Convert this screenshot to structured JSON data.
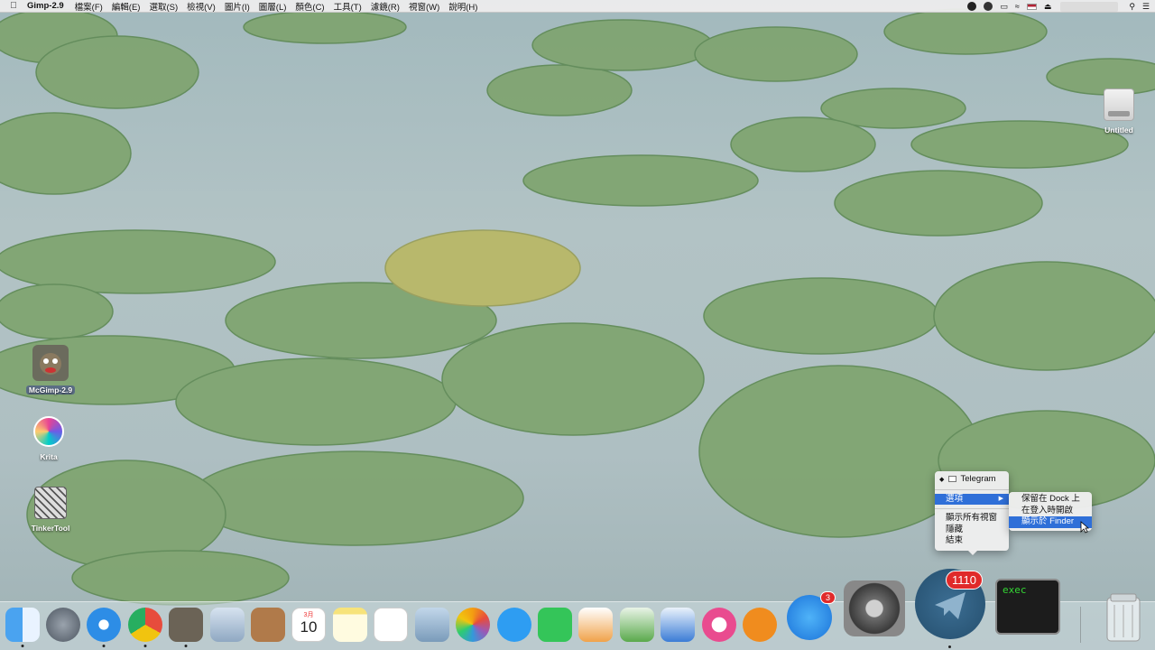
{
  "menubar": {
    "app_name": "Gimp-2.9",
    "menus": [
      "檔案(F)",
      "編輯(E)",
      "選取(S)",
      "檢視(V)",
      "圖片(I)",
      "圖層(L)",
      "顏色(C)",
      "工具(T)",
      "濾鏡(R)",
      "視窗(W)",
      "說明(H)"
    ],
    "status_icons": [
      "dropbox-icon",
      "creative-cloud-icon",
      "airplay-icon",
      "wifi-icon",
      "flag-us-icon",
      "eject-icon"
    ]
  },
  "desktop": {
    "drive_label": "Untitled",
    "icons": [
      {
        "label": "McGimp-2.9",
        "icon": "gimp-icon"
      },
      {
        "label": "Krita",
        "icon": "krita-icon"
      },
      {
        "label": "TinkerTool",
        "icon": "tinkertool-icon"
      }
    ]
  },
  "context_menu": {
    "title": "Telegram",
    "options_label": "選項",
    "items": [
      "顯示所有視窗",
      "隱藏",
      "結束"
    ],
    "submenu": [
      "保留在 Dock 上",
      "在登入時開啟",
      "顯示於 Finder"
    ]
  },
  "dock": {
    "calendar_month": "3月",
    "calendar_day": "10",
    "appstore_badge": "3",
    "telegram_badge": "1110",
    "terminal_text": "exec",
    "apps": [
      "finder-icon",
      "launchpad-icon",
      "safari-icon",
      "chrome-icon",
      "gimp-icon",
      "mail-icon",
      "contacts-icon",
      "calendar-icon",
      "notes-icon",
      "reminders-icon",
      "preview-icon",
      "photos-icon",
      "messages-icon",
      "facetime-icon",
      "pages-icon",
      "numbers-icon",
      "keynote-icon",
      "itunes-icon",
      "ibooks-icon",
      "appstore-icon",
      "system-preferences-icon",
      "telegram-icon",
      "terminal-icon",
      "trash-icon"
    ]
  }
}
